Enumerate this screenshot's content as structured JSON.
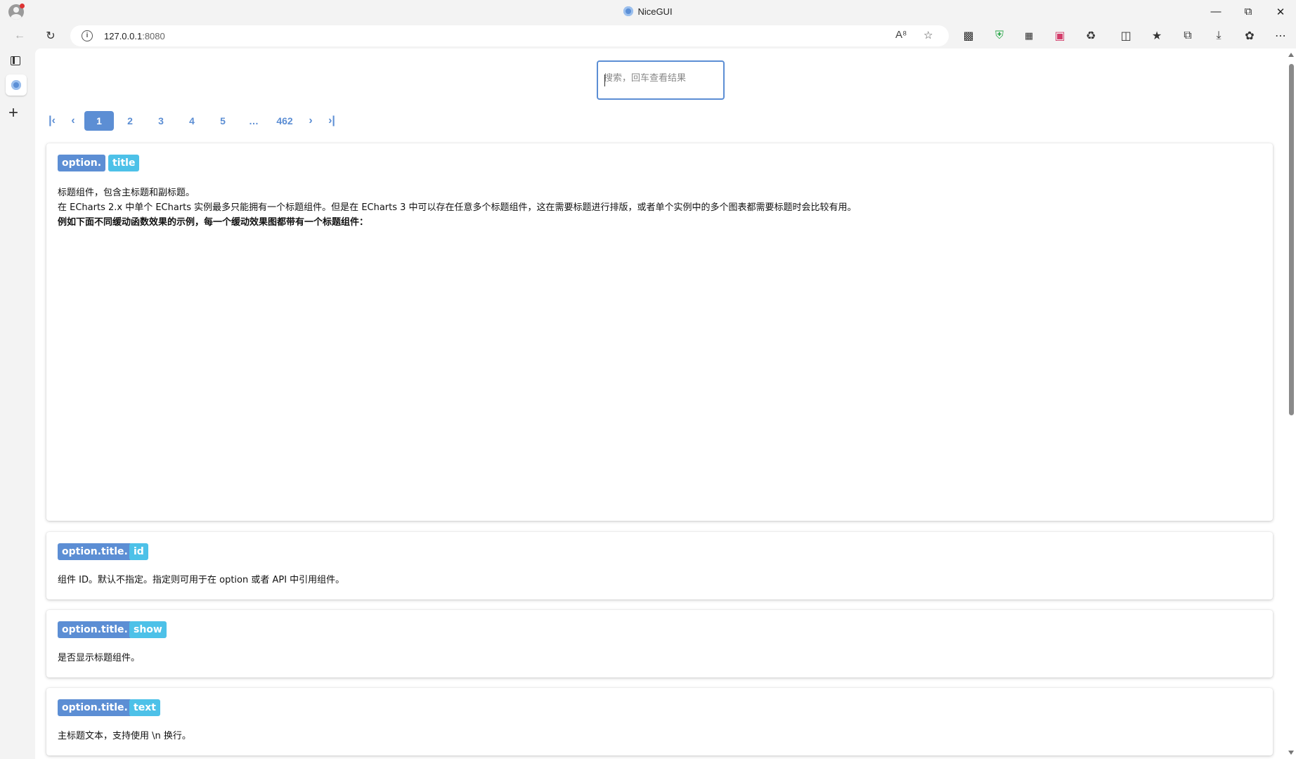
{
  "window": {
    "title": "NiceGUI",
    "controls": [
      "minimize-icon",
      "restore-icon",
      "close-icon"
    ]
  },
  "toolbar": {
    "url_host": "127.0.0.1",
    "url_port": ":8080",
    "icons": [
      "back-icon",
      "refresh-icon",
      "info-icon",
      "read-aloud-icon",
      "favorite-star-icon",
      "extension-icon",
      "shield-icon",
      "qr-icon",
      "translate-icon",
      "puzzle-icon",
      "split-screen-icon",
      "favorites-icon",
      "collections-icon",
      "download-icon",
      "copilot-icon",
      "more-icon"
    ]
  },
  "search": {
    "placeholder": "搜索，回车查看结果"
  },
  "pagination": {
    "pages": [
      "1",
      "2",
      "3",
      "4",
      "5",
      "…",
      "462"
    ],
    "current": "1"
  },
  "cards": [
    {
      "path": "option.",
      "key": "title",
      "lines": [
        "标题组件，包含主标题和副标题。",
        "在 ECharts 2.x 中单个 ECharts 实例最多只能拥有一个标题组件。但是在 ECharts 3 中可以存在任意多个标题组件，这在需要标题进行排版，或者单个实例中的多个图表都需要标题时会比较有用。",
        "例如下面不同缓动函数效果的示例，每一个缓动效果图都带有一个标题组件："
      ]
    },
    {
      "path": "option.title.",
      "key": "id",
      "lines": [
        "组件 ID。默认不指定。指定则可用于在 option 或者 API 中引用组件。"
      ]
    },
    {
      "path": "option.title.",
      "key": "show",
      "lines": [
        "是否显示标题组件。"
      ]
    },
    {
      "path": "option.title.",
      "key": "text",
      "lines": [
        "主标题文本，支持使用 \\n 换行。"
      ]
    }
  ],
  "colors": {
    "accent": "#5c8ed4",
    "key_badge": "#4dc1e8"
  }
}
